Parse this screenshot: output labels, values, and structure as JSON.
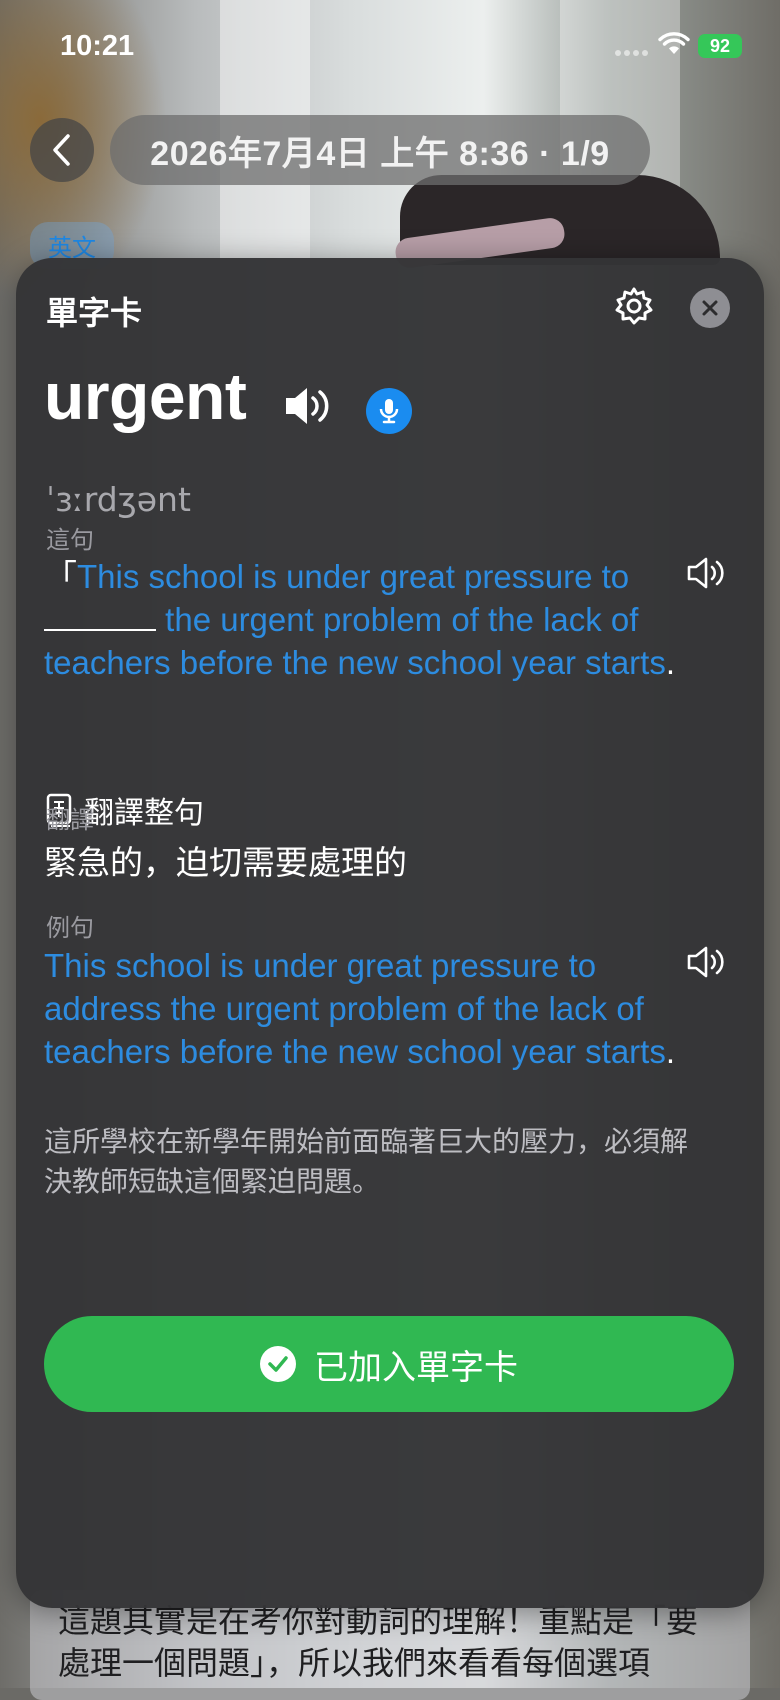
{
  "status_bar": {
    "time": "10:21",
    "battery": "92"
  },
  "header": {
    "title": "2026年7月4日 上午 8:36 · 1/9",
    "language_tag": "英文"
  },
  "card": {
    "title": "單字卡",
    "word": "urgent",
    "phonetic": "ˈɜːrdʒənt",
    "context_label": "這句",
    "context_sentence": {
      "open_quote": "「",
      "part1": "This school is under great pressure to",
      "part2": " the urgent problem of the lack of teachers before the new school year starts",
      "end": "."
    },
    "translate_sentence_label": "翻譯整句",
    "translation_label": "翻譯",
    "translation": "緊急的，迫切需要處理的",
    "example_label": "例句",
    "example_sentence": "This school is under great pressure to address the urgent problem of the lack of teachers before the new school year starts",
    "example_end": ".",
    "example_translation": "這所學校在新學年開始前面臨著巨大的壓力，必須解決教師短缺這個緊迫問題。",
    "added_button_label": "已加入單字卡"
  },
  "background_text": "這題其實是在考你對動詞的理解！重點是「要處理一個問題」，所以我們來看看每個選項",
  "colors": {
    "accent_blue": "#2d8ce0",
    "success_green": "#30b852"
  }
}
